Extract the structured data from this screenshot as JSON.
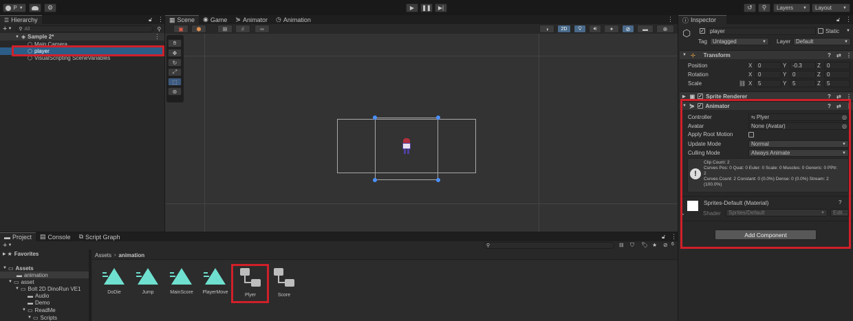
{
  "toolbar": {
    "account_label": "P",
    "play_icon": "play-icon",
    "pause_icon": "pause-icon",
    "step_icon": "step-icon",
    "layers_label": "Layers",
    "layout_label": "Layout"
  },
  "hierarchy": {
    "tab_label": "Hierarchy",
    "search_placeholder": "All",
    "scene_name": "Sample 2*",
    "items": [
      {
        "label": "Main Camera"
      },
      {
        "label": "player"
      },
      {
        "label": "VisualScripting SceneVariables"
      }
    ]
  },
  "scene": {
    "tabs": [
      {
        "label": "Scene"
      },
      {
        "label": "Game"
      },
      {
        "label": "Animator"
      },
      {
        "label": "Animation"
      }
    ],
    "mode_2d": "2D"
  },
  "inspector": {
    "tab_label": "Inspector",
    "object_name": "player",
    "static_label": "Static",
    "tag_label": "Tag",
    "tag_value": "Untagged",
    "layer_label": "Layer",
    "layer_value": "Default",
    "transform": {
      "title": "Transform",
      "rows": [
        {
          "label": "Position",
          "x": "0",
          "y": "-0.3",
          "z": "0"
        },
        {
          "label": "Rotation",
          "x": "0",
          "y": "0",
          "z": "0"
        },
        {
          "label": "Scale",
          "x": "5",
          "y": "5",
          "z": "5"
        }
      ],
      "x": "X",
      "y": "Y",
      "z": "Z"
    },
    "sprite_renderer": {
      "title": "Sprite Renderer"
    },
    "animator": {
      "title": "Animator",
      "controller_label": "Controller",
      "controller_value": "Plyer",
      "avatar_label": "Avatar",
      "avatar_value": "None (Avatar)",
      "root_motion_label": "Apply Root Motion",
      "update_mode_label": "Update Mode",
      "update_mode_value": "Normal",
      "culling_mode_label": "Culling Mode",
      "culling_mode_value": "Always Animate",
      "info_lines": [
        "Clip Count: 2",
        "Curves Pos: 0 Quat: 0 Euler: 0 Scale: 0 Muscles: 0 Generic: 0 PPtr:",
        "2",
        "Curves Count: 2 Constant: 0 (0.0%) Dense: 0 (0.0%) Stream: 2",
        "(100.0%)"
      ]
    },
    "material": {
      "name": "Sprites-Default (Material)",
      "shader_label": "Shader",
      "shader_value": "Sprites/Default",
      "edit_label": "Edit..."
    },
    "add_component_label": "Add Component"
  },
  "project": {
    "tabs": [
      {
        "label": "Project"
      },
      {
        "label": "Console"
      },
      {
        "label": "Script Graph"
      }
    ],
    "favorites_label": "Favorites",
    "breadcrumb": [
      "Assets",
      "animation"
    ],
    "hidden_count": "6",
    "tree": [
      {
        "label": "Assets",
        "indent": 0
      },
      {
        "label": "animation",
        "indent": 1
      },
      {
        "label": "asset",
        "indent": 1
      },
      {
        "label": "Bolt 2D DinoRun VE1",
        "indent": 2
      },
      {
        "label": "Audio",
        "indent": 3
      },
      {
        "label": "Demo",
        "indent": 3
      },
      {
        "label": "ReadMe",
        "indent": 2
      },
      {
        "label": "Scripts",
        "indent": 3
      }
    ],
    "assets": [
      {
        "name": "DoDie",
        "kind": "animation-clip"
      },
      {
        "name": "Jump",
        "kind": "animation-clip"
      },
      {
        "name": "MainScore",
        "kind": "animation-clip"
      },
      {
        "name": "PlayerMove",
        "kind": "animation-clip"
      },
      {
        "name": "Plyer",
        "kind": "animator-controller"
      },
      {
        "name": "Score",
        "kind": "animator-controller"
      }
    ]
  },
  "colors": {
    "highlight": "#d0202a",
    "selection": "#2c5d87",
    "clip_teal": "#6fe0cf"
  }
}
